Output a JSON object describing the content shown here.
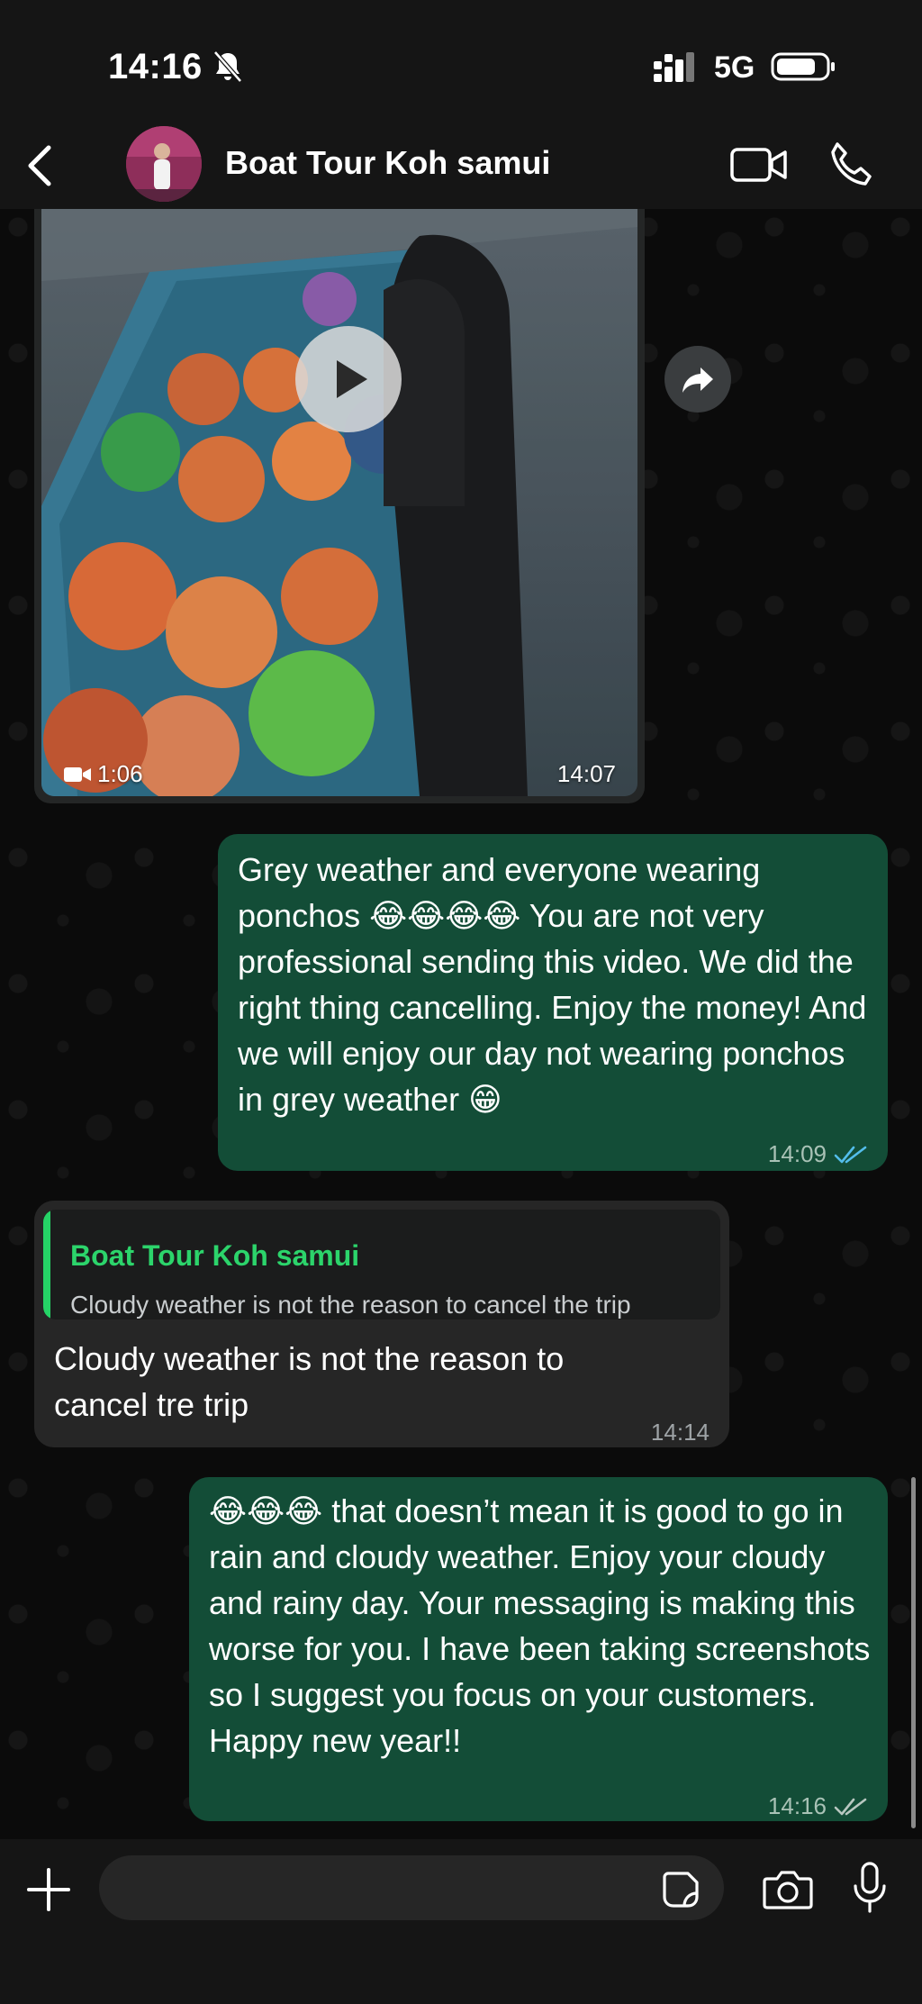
{
  "status": {
    "time": "14:16",
    "network": "5G"
  },
  "header": {
    "title": "Boat Tour Koh samui"
  },
  "messages": [
    {
      "type": "video",
      "direction": "incoming",
      "duration": "1:06",
      "time": "14:07"
    },
    {
      "type": "text",
      "direction": "outgoing",
      "text": "Grey weather and everyone wearing ponchos 😂😂😂😂 You are not very professional sending this video. We did the right thing cancelling. Enjoy the money! And we will enjoy our day not wearing ponchos in grey weather 😁",
      "time": "14:09",
      "status": "read"
    },
    {
      "type": "reply",
      "direction": "incoming",
      "quote_author": "Boat Tour Koh samui",
      "quote_text": "Cloudy weather is not the reason to cancel the trip",
      "text": "Cloudy weather is not the reason to cancel tre trip",
      "time": "14:14"
    },
    {
      "type": "text",
      "direction": "outgoing",
      "text": "😂😂😂 that doesn’t mean it is good to go in rain and cloudy weather. Enjoy your cloudy and rainy day. Your messaging is making this worse for you. I have been taking screenshots so I suggest you focus on your customers. Happy new year!!",
      "time": "14:16",
      "status": "delivered"
    }
  ],
  "composer": {
    "placeholder": ""
  },
  "colors": {
    "outgoing_bubble": "#134d37",
    "incoming_bubble": "#262626",
    "read_tick": "#53bdeb",
    "quote_author": "#2cd46b"
  }
}
